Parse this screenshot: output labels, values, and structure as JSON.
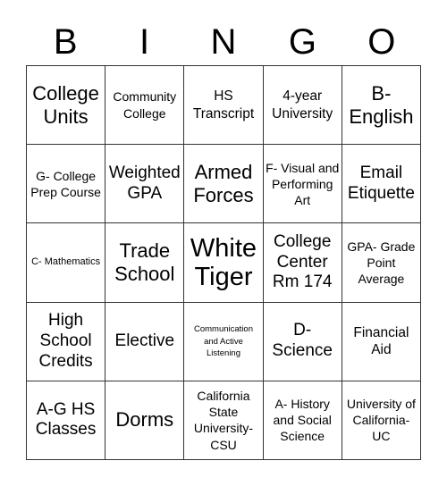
{
  "header": {
    "letters": [
      "B",
      "I",
      "N",
      "G",
      "O"
    ]
  },
  "grid": {
    "rows": [
      [
        {
          "text": "College Units"
        },
        {
          "text": "Community College"
        },
        {
          "text": "HS Transcript"
        },
        {
          "text": "4-year University"
        },
        {
          "text": "B- English"
        }
      ],
      [
        {
          "text": "G- College Prep Course"
        },
        {
          "text": "Weighted GPA"
        },
        {
          "text": "Armed Forces"
        },
        {
          "text": "F- Visual and Performing Art"
        },
        {
          "text": "Email Etiquette"
        }
      ],
      [
        {
          "text": "C- Mathematics"
        },
        {
          "text": "Trade School"
        },
        {
          "text": "White Tiger"
        },
        {
          "text": "College Center Rm 174"
        },
        {
          "text": "GPA- Grade Point Average"
        }
      ],
      [
        {
          "text": "High School Credits"
        },
        {
          "text": "Elective"
        },
        {
          "text": "Communication and Active Listening"
        },
        {
          "text": "D- Science"
        },
        {
          "text": "Financial Aid"
        }
      ],
      [
        {
          "text": "A-G HS Classes"
        },
        {
          "text": "Dorms"
        },
        {
          "text": "California State University-CSU"
        },
        {
          "text": "A- History and Social Science"
        },
        {
          "text": "University of California-UC"
        }
      ]
    ]
  }
}
